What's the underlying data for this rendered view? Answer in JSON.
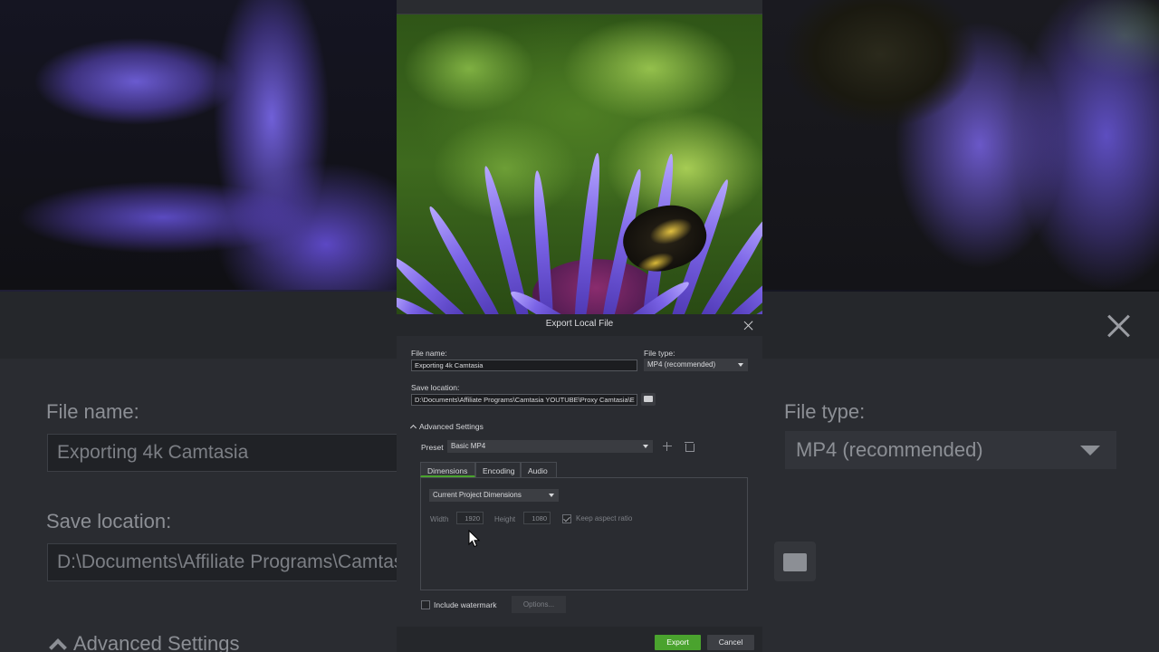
{
  "background": {
    "file_name_label": "File name:",
    "file_name_value": "Exporting 4k Camtasia",
    "save_location_label": "Save location:",
    "save_location_value": "D:\\Documents\\Affiliate Programs\\Camtasia YOUTUBE\\Proxy Camtasia\\",
    "file_type_label": "File type:",
    "file_type_value": "MP4 (recommended)",
    "advanced_settings": "Advanced Settings"
  },
  "dialog": {
    "title": "Export Local File",
    "file_name_label": "File name:",
    "file_name_value": "Exporting 4k Camtasia",
    "file_type_label": "File type:",
    "file_type_value": "MP4 (recommended)",
    "save_location_label": "Save location:",
    "save_location_value": "D:\\Documents\\Affiliate Programs\\Camtasia YOUTUBE\\Proxy Camtasia\\E",
    "advanced_settings": "Advanced Settings",
    "preset_label": "Preset",
    "preset_value": "Basic MP4",
    "tabs": [
      {
        "label": "Dimensions"
      },
      {
        "label": "Encoding"
      },
      {
        "label": "Audio"
      }
    ],
    "dimensions": {
      "mode": "Current Project Dimensions",
      "width_label": "Width",
      "width_value": "1920",
      "height_label": "Height",
      "height_value": "1080",
      "keep_aspect": "Keep aspect ratio"
    },
    "watermark_label": "Include watermark",
    "options_label": "Options...",
    "export_label": "Export",
    "cancel_label": "Cancel"
  },
  "colors": {
    "accent": "#4aa32e",
    "dialog_bg": "#2a2c31"
  }
}
